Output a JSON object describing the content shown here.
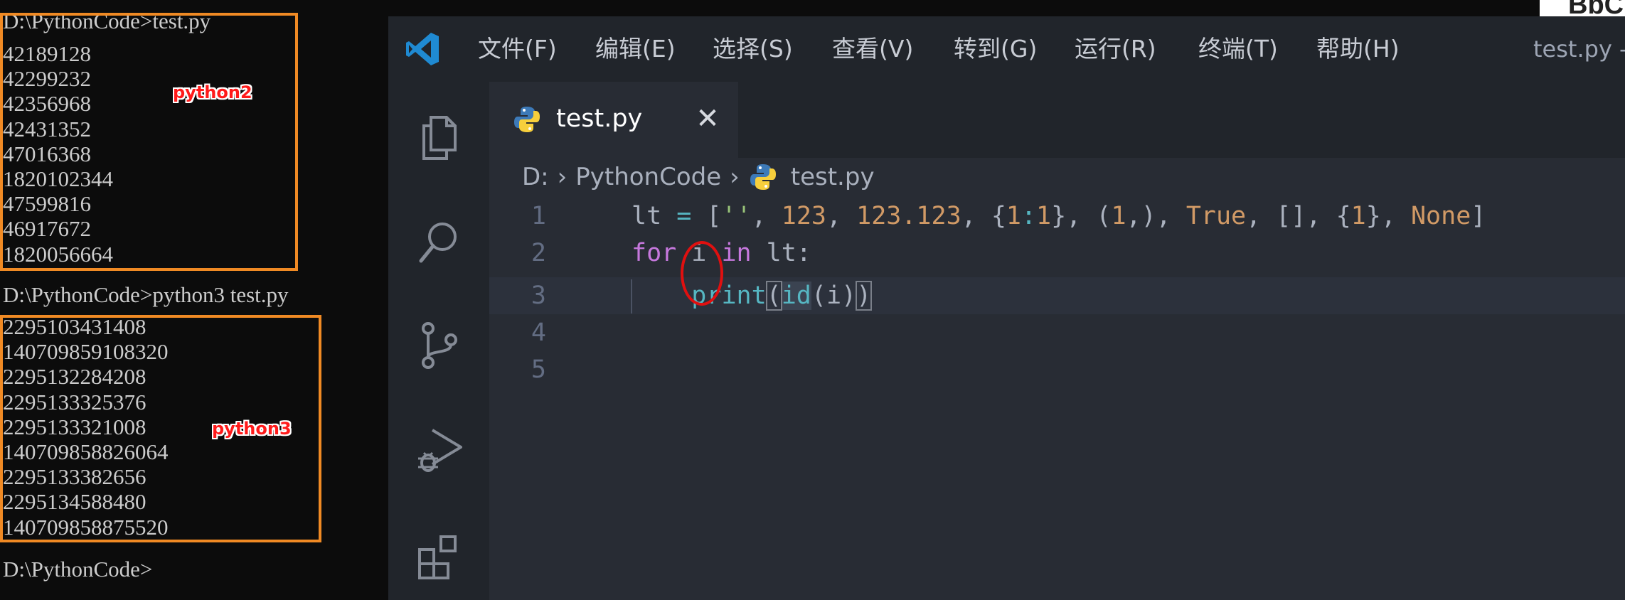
{
  "terminal": {
    "prompt1": "D:\\PythonCode>test.py",
    "python2_output": [
      "42189128",
      "42299232",
      "42356968",
      "42431352",
      "47016368",
      "1820102344",
      "47599816",
      "46917672",
      "1820056664"
    ],
    "python2_label": "python2",
    "prompt2": "D:\\PythonCode>python3 test.py",
    "python3_output": [
      "2295103431408",
      "140709859108320",
      "2295132284208",
      "2295133325376",
      "2295133321008",
      "140709858826064",
      "2295133382656",
      "2295134588480",
      "140709858875520"
    ],
    "python3_label": "python3",
    "prompt3": "D:\\PythonCode>",
    "highlight_color": "#f08a24"
  },
  "vscode": {
    "menu": [
      "文件(F)",
      "编辑(E)",
      "选择(S)",
      "查看(V)",
      "转到(G)",
      "运行(R)",
      "终端(T)",
      "帮助(H)"
    ],
    "window_title": "test.py -",
    "tab": {
      "label": "test.py",
      "close": "✕"
    },
    "breadcrumb": [
      "D:",
      "PythonCode",
      "test.py"
    ],
    "line_numbers": [
      "1",
      "2",
      "3",
      "4",
      "5"
    ],
    "code": {
      "line1": {
        "var": "lt",
        "eq": " = ",
        "open": "[",
        "s": "''",
        "c1": ", ",
        "n1": "123",
        "c2": ", ",
        "n2": "123.123",
        "c3": ", ",
        "d_open": "{",
        "d_k": "1",
        "d_colon": ":",
        "d_v": "1",
        "d_close": "}",
        "c4": ", ",
        "t_open": "(",
        "t_v": "1",
        "t_comma": ",",
        "t_close": ")",
        "c5": ", ",
        "b": "True",
        "c6": ", ",
        "l": "[]",
        "c7": ", ",
        "set_open": "{",
        "set_v": "1",
        "set_close": "}",
        "c8": ", ",
        "none": "None",
        "close": "]"
      },
      "line2": {
        "kw_for": "for",
        "sp1": " i ",
        "kw_in": "in",
        "sp2": " lt:"
      },
      "line3": {
        "indent": "    ",
        "fn": "print",
        "p_open": "(",
        "bi": "id",
        "inner": "(i)",
        "p_close": ")"
      }
    },
    "colors": {
      "annotation": "#e01010",
      "editor_bg": "#282c34"
    }
  }
}
